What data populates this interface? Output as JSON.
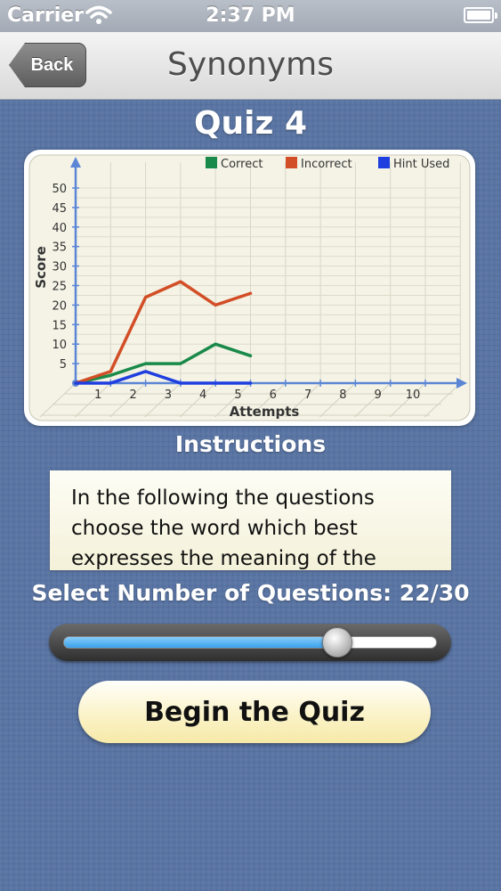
{
  "status_bar": {
    "carrier": "Carrier",
    "time": "2:37 PM"
  },
  "nav": {
    "back_label": "Back",
    "title": "Synonyms"
  },
  "quiz": {
    "title": "Quiz 4"
  },
  "chart_data": {
    "type": "line",
    "xlabel": "Attempts",
    "ylabel": "Score",
    "x_ticks": [
      1,
      2,
      3,
      4,
      5,
      6,
      7,
      8,
      9,
      10
    ],
    "y_ticks": [
      5,
      10,
      15,
      20,
      25,
      30,
      35,
      40,
      45,
      50
    ],
    "xlim": [
      0,
      11
    ],
    "ylim": [
      0,
      52
    ],
    "legend_position": "top-right",
    "grid": true,
    "x": [
      0,
      1,
      2,
      3,
      4,
      5
    ],
    "series": [
      {
        "name": "Correct",
        "color": "#1a8a4a",
        "values": [
          0,
          2,
          5,
          5,
          10,
          7
        ]
      },
      {
        "name": "Incorrect",
        "color": "#d24e26",
        "values": [
          0,
          3,
          22,
          26,
          20,
          23
        ]
      },
      {
        "name": "Hint Used",
        "color": "#1e3ee0",
        "values": [
          0,
          0,
          3,
          0,
          0,
          0
        ]
      }
    ]
  },
  "instructions": {
    "label": "Instructions",
    "text": "In the following the questions choose the word which best expresses the meaning of the given word."
  },
  "question_selector": {
    "label": "Select Number of Questions: 22/30",
    "value": 22,
    "max": 30
  },
  "begin_button": {
    "label": "Begin the Quiz"
  }
}
